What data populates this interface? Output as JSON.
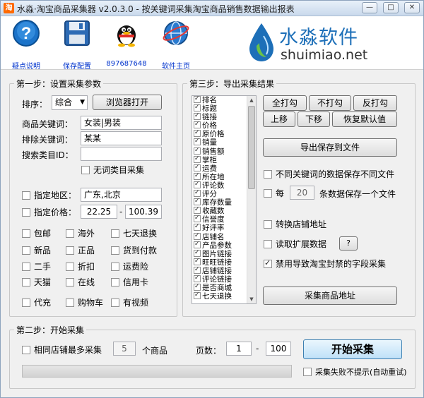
{
  "window": {
    "app_icon": "淘",
    "title": "水淼·淘宝商品采集器 v2.0.3.0 - 按关键词采集淘宝商品销售数据输出报表",
    "buttons": [
      "minimize-icon",
      "maximize-icon",
      "close-icon"
    ]
  },
  "toolbar": {
    "items": [
      {
        "label": "疑点说明",
        "icon": "help-icon"
      },
      {
        "label": "保存配置",
        "icon": "save-icon"
      },
      {
        "label": "897687648",
        "icon": "qq-icon"
      },
      {
        "label": "软件主页",
        "icon": "globe-icon"
      }
    ],
    "brand_cn": "水淼软件",
    "brand_en": "shuimiao.net",
    "brand_color": "#1d6fb8"
  },
  "step1": {
    "title": "第一步：设置采集参数",
    "sort_label": "排序：",
    "sort_value": "综合",
    "browser_button": "浏览器打开",
    "keyword_label": "商品关键词：",
    "keyword_value": "女装|男装",
    "exclude_label": "排除关键词：",
    "exclude_value": "某某",
    "category_label": "搜索类目ID：",
    "category_value": "",
    "no_category_label": "无词类目采集",
    "region_label": "指定地区：",
    "region_value": "广东,北京",
    "price_label": "指定价格：",
    "price_min": "22.25",
    "price_sep": "-",
    "price_max": "100.39",
    "options": [
      "包邮",
      "海外",
      "七天退换",
      "新品",
      "正品",
      "货到付款",
      "二手",
      "折扣",
      "运费险",
      "天猫",
      "在线",
      "信用卡",
      "代充",
      "购物车",
      "有视频"
    ]
  },
  "step3": {
    "title": "第三步：导出采集结果",
    "fields": [
      "排名",
      "标题",
      "链接",
      "价格",
      "原价格",
      "销量",
      "销售额",
      "掌柜",
      "运费",
      "所在地",
      "评论数",
      "评分",
      "库存数量",
      "收藏数",
      "信誉度",
      "好评率",
      "店铺名",
      "产品参数",
      "图片链接",
      "旺旺链接",
      "店铺链接",
      "评论链接",
      "是否商城",
      "七天退换"
    ],
    "btn_check_all": "全打勾",
    "btn_uncheck": "不打勾",
    "btn_invert": "反打勾",
    "btn_up": "上移",
    "btn_down": "下移",
    "btn_reset": "恢复默认值",
    "btn_export": "导出保存到文件",
    "opt_split_keyword": "不同关键词的数据保存不同文件",
    "opt_every": "每",
    "every_value": "20",
    "opt_every_suffix": "条数据保存一个文件",
    "opt_convert_shop": "转换店铺地址",
    "opt_read_ext": "读取扩展数据",
    "help_button": "?",
    "opt_disable_ban": "禁用导致淘宝封禁的字段采集",
    "btn_collect_urls": "采集商品地址"
  },
  "step2": {
    "title": "第二步：开始采集",
    "same_shop_label": "相同店铺最多采集",
    "same_shop_value": "5",
    "same_shop_unit": "个商品",
    "pages_label": "页数：",
    "page_from": "1",
    "page_sep": "-",
    "page_to": "100",
    "start_button": "开始采集",
    "progress_percent": 0,
    "no_prompt_label": "采集失败不提示(自动重试)"
  }
}
